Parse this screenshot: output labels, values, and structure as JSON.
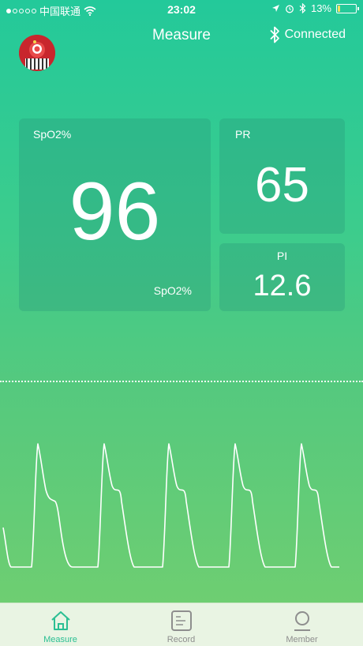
{
  "status_bar": {
    "carrier": "中国联通",
    "time": "23:02",
    "battery": "13%",
    "battery_level": 0.13
  },
  "header": {
    "title": "Measure",
    "connection_status": "Connected"
  },
  "spo2_card": {
    "label_top": "SpO2%",
    "value": "96",
    "label_bottom": "SpO2%"
  },
  "pr_card": {
    "label": "PR",
    "value": "65"
  },
  "pi_card": {
    "label": "PI",
    "value": "12.6"
  },
  "tabs": [
    {
      "label": "Measure",
      "icon": "home-icon",
      "active": true
    },
    {
      "label": "Record",
      "icon": "record-icon",
      "active": false
    },
    {
      "label": "Member",
      "icon": "member-icon",
      "active": false
    }
  ],
  "colors": {
    "accent": "#2bbf93",
    "battery": "#f6e05c"
  }
}
